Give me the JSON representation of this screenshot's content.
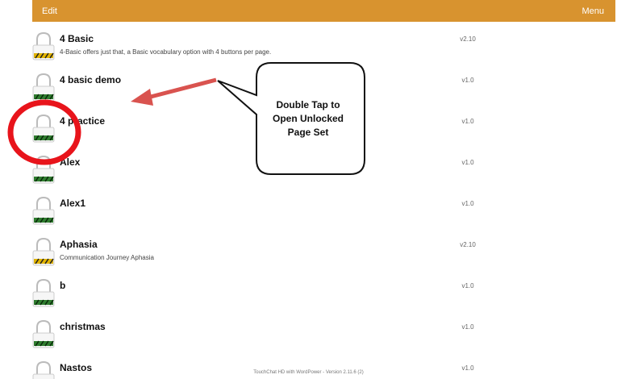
{
  "header": {
    "edit_label": "Edit",
    "menu_label": "Menu"
  },
  "rows": [
    {
      "title": "4 Basic",
      "desc": "4-Basic offers just that, a Basic vocabulary option with 4 buttons per page.",
      "version": "v2.10",
      "lock": "locked-striped"
    },
    {
      "title": "4 basic demo",
      "desc": "",
      "version": "v1.0",
      "lock": "unlocked-green"
    },
    {
      "title": "4 practice",
      "desc": "",
      "version": "v1.0",
      "lock": "unlocked-green"
    },
    {
      "title": "Alex",
      "desc": "",
      "version": "v1.0",
      "lock": "unlocked-green"
    },
    {
      "title": "Alex1",
      "desc": "",
      "version": "v1.0",
      "lock": "unlocked-green"
    },
    {
      "title": "Aphasia",
      "desc": "Communication Journey Aphasia",
      "version": "v2.10",
      "lock": "locked-striped"
    },
    {
      "title": "b",
      "desc": "",
      "version": "v1.0",
      "lock": "unlocked-green"
    },
    {
      "title": "christmas",
      "desc": "",
      "version": "v1.0",
      "lock": "unlocked-green"
    },
    {
      "title": "Nastos",
      "desc": "",
      "version": "v1.0",
      "lock": "unlocked-green"
    }
  ],
  "callout": {
    "line1": "Double Tap to",
    "line2": "Open Unlocked",
    "line3": "Page Set"
  },
  "footer": {
    "text": "TouchChat HD with WordPower - Version 2.11.6 (2)"
  },
  "colors": {
    "header": "#d8932f",
    "arrow": "#d9534f",
    "highlight_circle": "#e8141b",
    "lock_green": "#2f7d2f",
    "lock_yellow": "#e2b400"
  }
}
